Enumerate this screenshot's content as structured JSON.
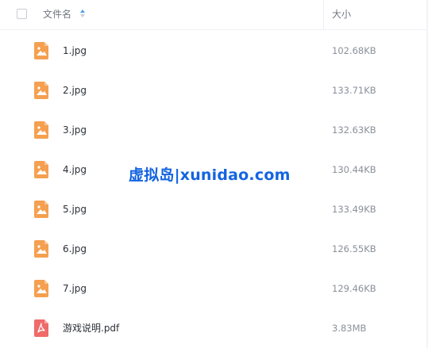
{
  "header": {
    "name_label": "文件名",
    "size_label": "大小"
  },
  "files": [
    {
      "name": "1.jpg",
      "size": "102.68KB",
      "type": "image"
    },
    {
      "name": "2.jpg",
      "size": "133.71KB",
      "type": "image"
    },
    {
      "name": "3.jpg",
      "size": "132.63KB",
      "type": "image"
    },
    {
      "name": "4.jpg",
      "size": "130.44KB",
      "type": "image"
    },
    {
      "name": "5.jpg",
      "size": "133.49KB",
      "type": "image"
    },
    {
      "name": "6.jpg",
      "size": "126.55KB",
      "type": "image"
    },
    {
      "name": "7.jpg",
      "size": "129.46KB",
      "type": "image"
    },
    {
      "name": "游戏说明.pdf",
      "size": "3.83MB",
      "type": "pdf"
    }
  ],
  "watermark": "虚拟岛|xunidao.com",
  "colors": {
    "image_icon": "#f5a050",
    "pdf_icon": "#f06a6a",
    "sort_accent": "#4a9eea",
    "watermark": "#1464e0"
  },
  "icons": {
    "image": "image-file-icon",
    "pdf": "pdf-file-icon",
    "sort": "sort-arrows-icon"
  }
}
